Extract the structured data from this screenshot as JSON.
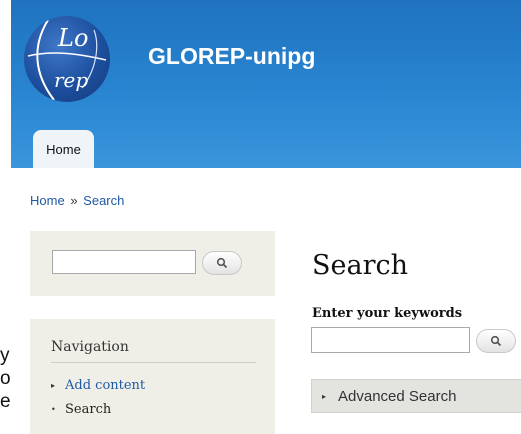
{
  "site": {
    "name": "GLOREP-unipg",
    "logo_top_text": "Lo",
    "logo_bottom_text": "rep"
  },
  "tabs": [
    {
      "label": "Home"
    }
  ],
  "breadcrumb": {
    "items": [
      "Home",
      "Search"
    ],
    "separator": "»"
  },
  "sidebar": {
    "search": {
      "button_icon": "magnifier-icon"
    },
    "navigation": {
      "title": "Navigation",
      "items": [
        {
          "label": "Add content",
          "bullet": "▸"
        },
        {
          "label": "Search",
          "bullet": "•"
        }
      ]
    },
    "cut_off_text": [
      "y",
      "o",
      "e"
    ]
  },
  "main": {
    "title": "Search",
    "keywords_label": "Enter your keywords",
    "advanced_search_label": "Advanced Search",
    "advanced_search_icon": "▸"
  },
  "colors": {
    "header_blue": "#2a87d2",
    "link_blue": "#1f5aa5",
    "block_bg": "#f0efe7"
  }
}
